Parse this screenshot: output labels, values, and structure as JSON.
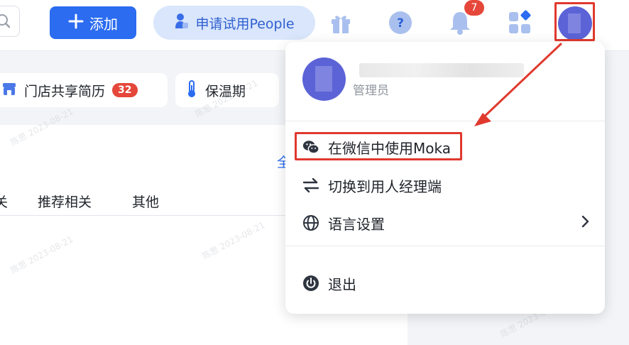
{
  "header": {
    "add_label": "添加",
    "trial_label": "申请试用People",
    "notification_count": "7"
  },
  "chips": [
    {
      "label": "门店共享简历",
      "count": "32"
    },
    {
      "label": "保温期"
    }
  ],
  "content": {
    "link_partial": "全",
    "tab_partial": "关",
    "tab_recommend": "推荐相关",
    "tab_other": "其他"
  },
  "dropdown": {
    "role": "管理员",
    "items": {
      "wechat": "在微信中使用Moka",
      "switch": "切换到用人经理端",
      "language": "语言设置",
      "logout": "退出"
    }
  },
  "watermark": {
    "text": "陈思 2023-08-21"
  },
  "colors": {
    "primary": "#2b6cf0",
    "badge": "#e5473a",
    "highlight": "#e0392e",
    "avatar": "#5b63d6"
  }
}
